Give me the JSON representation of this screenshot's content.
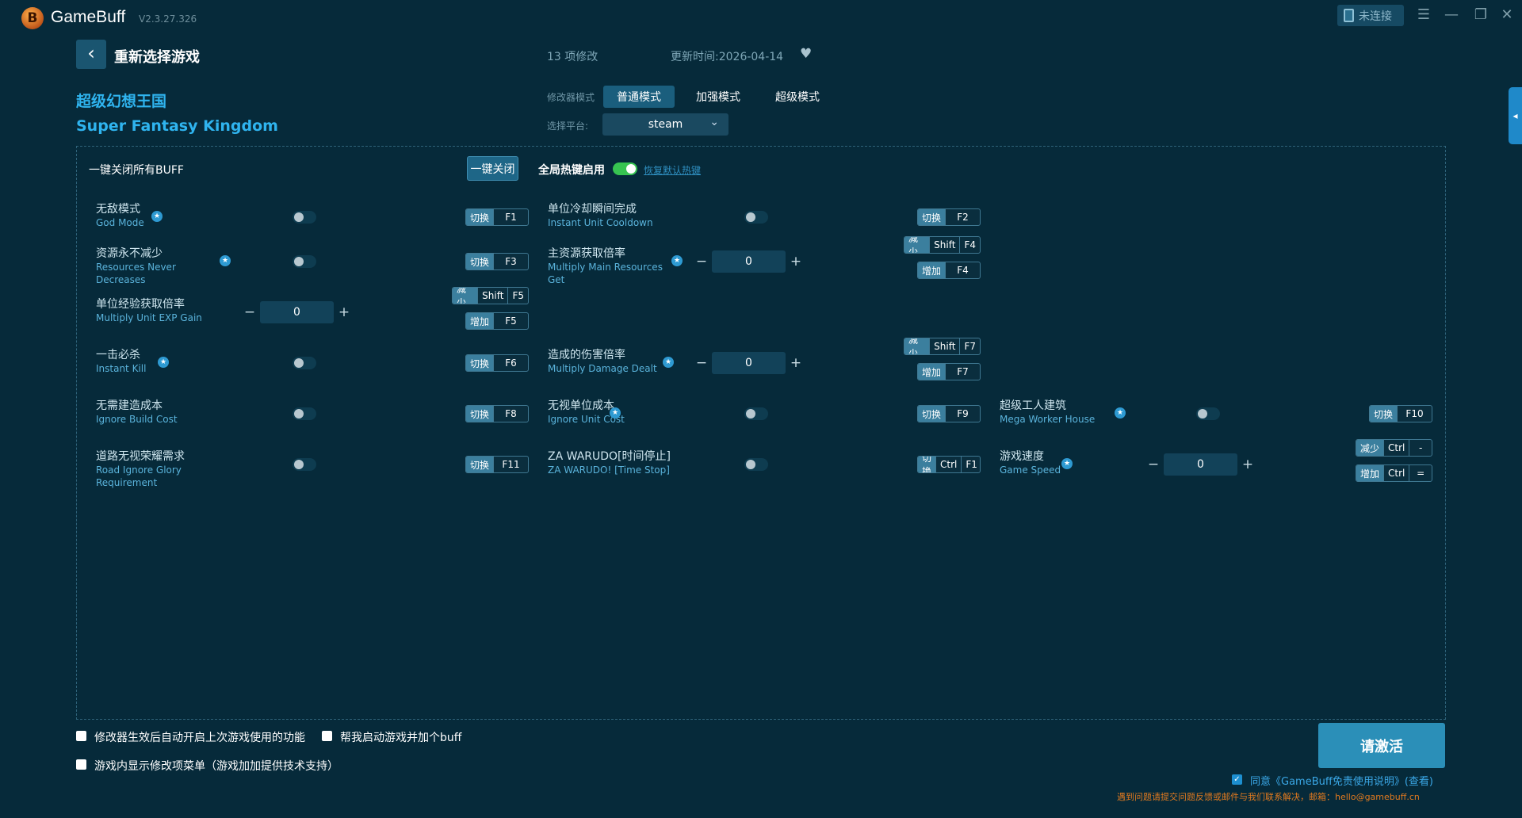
{
  "app": {
    "logo_letter": "B",
    "name": "GameBuff",
    "version": "V2.3.27.326",
    "connection": "未连接"
  },
  "header": {
    "back_label": "重新选择游戏",
    "mod_count": "13 项修改",
    "updated": "更新时间:2026-04-14",
    "game_title_cn": "超级幻想王国",
    "game_title_en": "Super Fantasy Kingdom",
    "mode_label": "修改器模式",
    "modes": [
      "普通模式",
      "加强模式",
      "超级模式"
    ],
    "active_mode": "普通模式",
    "platform_label": "选择平台:",
    "platform": "steam"
  },
  "panel": {
    "close_all_label": "一键关闭所有BUFF",
    "close_all_button": "一键关闭",
    "global_hotkey_label": "全局热键启用",
    "global_hotkey_on": true,
    "restore_hotkeys": "恢复默认热键"
  },
  "cheats": [
    {
      "cn": "无敌模式",
      "en": "God Mode",
      "starred": true,
      "type": "toggle",
      "hotkeys": [
        {
          "action": "切换",
          "keys": [
            "F1"
          ]
        }
      ]
    },
    {
      "cn": "单位冷却瞬间完成",
      "en": "Instant Unit Cooldown",
      "starred": false,
      "type": "toggle",
      "hotkeys": [
        {
          "action": "切换",
          "keys": [
            "F2"
          ]
        }
      ]
    },
    {
      "cn": "资源永不减少",
      "en": "Resources Never Decreases",
      "starred": true,
      "type": "toggle",
      "hotkeys": [
        {
          "action": "切换",
          "keys": [
            "F3"
          ]
        }
      ]
    },
    {
      "cn": "主资源获取倍率",
      "en": "Multiply Main Resources Get",
      "starred": true,
      "type": "number",
      "value": "0",
      "hotkeys": [
        {
          "action": "减少",
          "keys": [
            "Shift",
            "F4"
          ]
        },
        {
          "action": "增加",
          "keys": [
            "F4"
          ]
        }
      ]
    },
    {
      "cn": "单位经验获取倍率",
      "en": "Multiply Unit EXP Gain",
      "starred": false,
      "type": "number",
      "value": "0",
      "hotkeys": [
        {
          "action": "减少",
          "keys": [
            "Shift",
            "F5"
          ]
        },
        {
          "action": "增加",
          "keys": [
            "F5"
          ]
        }
      ]
    },
    {
      "cn": "一击必杀",
      "en": "Instant Kill",
      "starred": true,
      "type": "toggle",
      "hotkeys": [
        {
          "action": "切换",
          "keys": [
            "F6"
          ]
        }
      ]
    },
    {
      "cn": "造成的伤害倍率",
      "en": "Multiply Damage Dealt",
      "starred": true,
      "type": "number",
      "value": "0",
      "hotkeys": [
        {
          "action": "减少",
          "keys": [
            "Shift",
            "F7"
          ]
        },
        {
          "action": "增加",
          "keys": [
            "F7"
          ]
        }
      ]
    },
    {
      "cn": "无需建造成本",
      "en": "Ignore Build Cost",
      "starred": false,
      "type": "toggle",
      "hotkeys": [
        {
          "action": "切换",
          "keys": [
            "F8"
          ]
        }
      ]
    },
    {
      "cn": "无视单位成本",
      "en": "Ignore Unit Cost",
      "starred": true,
      "type": "toggle",
      "hotkeys": [
        {
          "action": "切换",
          "keys": [
            "F9"
          ]
        }
      ]
    },
    {
      "cn": "超级工人建筑",
      "en": "Mega Worker House",
      "starred": true,
      "type": "toggle",
      "hotkeys": [
        {
          "action": "切换",
          "keys": [
            "F10"
          ]
        }
      ]
    },
    {
      "cn": "道路无视荣耀需求",
      "en": "Road Ignore Glory Requirement",
      "starred": false,
      "type": "toggle",
      "hotkeys": [
        {
          "action": "切换",
          "keys": [
            "F11"
          ]
        }
      ]
    },
    {
      "cn": "ZA WARUDO[时间停止]",
      "en": "ZA WARUDO! [Time Stop]",
      "starred": false,
      "type": "toggle",
      "hotkeys": [
        {
          "action": "切换",
          "keys": [
            "Ctrl",
            "F1"
          ]
        }
      ]
    },
    {
      "cn": "游戏速度",
      "en": "Game Speed",
      "starred": true,
      "type": "number",
      "value": "0",
      "hotkeys": [
        {
          "action": "减少",
          "keys": [
            "Ctrl",
            "-"
          ]
        },
        {
          "action": "增加",
          "keys": [
            "Ctrl",
            "="
          ]
        }
      ]
    }
  ],
  "footer": {
    "opt1": "修改器生效后自动开启上次游戏使用的功能",
    "opt2": "帮我启动游戏并加个buff",
    "opt3": "游戏内显示修改项菜单（游戏加加提供技术支持）",
    "activate": "请激活",
    "agree": "同意《GameBuff免责使用说明》(查看)",
    "contact": "遇到问题请提交问题反馈或邮件与我们联系解决，邮箱：hello@gamebuff.cn"
  },
  "colors": {
    "background": "#062a3a",
    "accent": "#2fb4ef",
    "toggle_on": "#37c451",
    "warning": "#e27a1f"
  },
  "icons": [
    "gamebuff-logo-icon",
    "device-icon",
    "menu-icon",
    "minimize-icon",
    "restore-icon",
    "close-icon",
    "back-arrow-icon",
    "heart-icon",
    "chevron-down-icon",
    "star-icon",
    "check-icon"
  ]
}
